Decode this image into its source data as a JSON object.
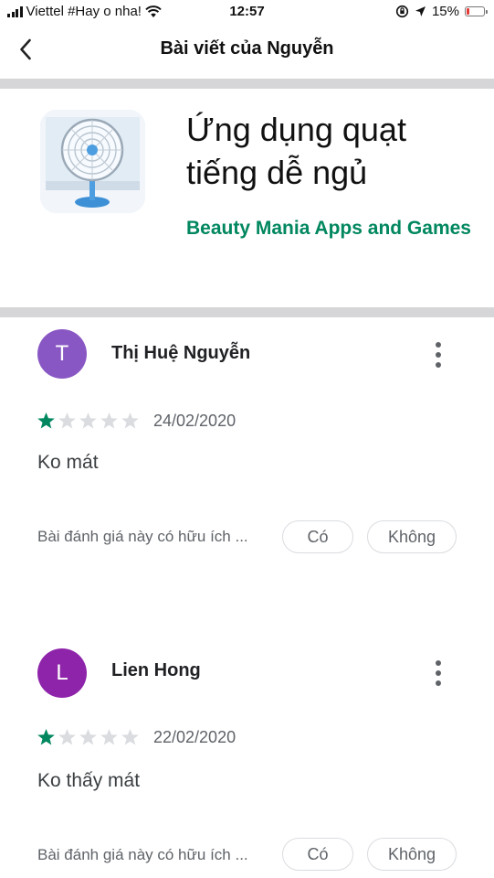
{
  "status_bar": {
    "carrier": "Viettel #Hay o nha!",
    "time": "12:57",
    "battery": "15%",
    "battery_level": 0.15,
    "battery_color": "#e53935"
  },
  "nav": {
    "title": "Bài viết của Nguyễn",
    "back_icon": "chevron-left-icon"
  },
  "app": {
    "icon": "fan-icon",
    "title": "Ứng dụng quạt tiếng dễ ngủ",
    "developer": "Beauty Mania Apps and Games",
    "developer_color": "#01875f"
  },
  "reviews": [
    {
      "initial": "T",
      "avatar_color": "#8957c4",
      "name": "Thị Huệ Nguyễn",
      "rating": 1,
      "max_rating": 5,
      "date": "24/02/2020",
      "text": "Ko mát",
      "helpful_prompt": "Bài đánh giá này có hữu ích ...",
      "yes_label": "Có",
      "no_label": "Không"
    },
    {
      "initial": "L",
      "avatar_color": "#8e24aa",
      "name": "Lien Hong",
      "rating": 1,
      "max_rating": 5,
      "date": "22/02/2020",
      "text": "Ko thấy mát",
      "helpful_prompt": "Bài đánh giá này có hữu ích ...",
      "yes_label": "Có",
      "no_label": "Không"
    }
  ],
  "colors": {
    "star_filled": "#01875f",
    "star_empty": "#dadce0"
  }
}
